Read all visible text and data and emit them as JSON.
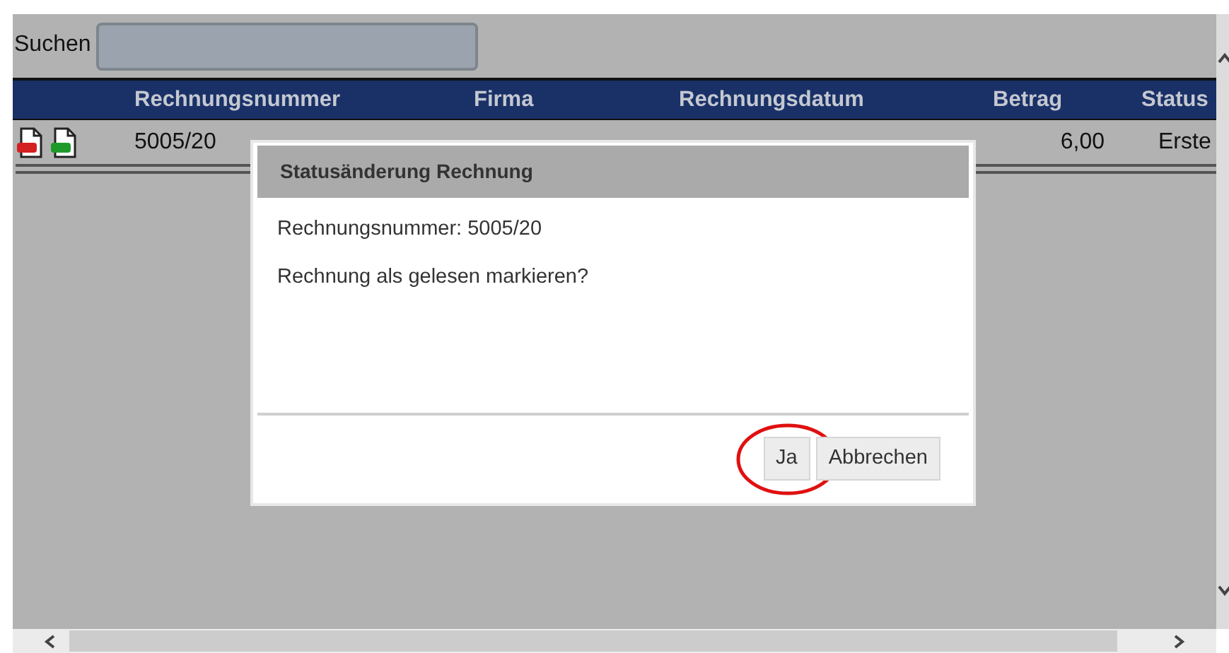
{
  "search": {
    "label": "Suchen"
  },
  "table": {
    "columns": [
      "Rechnungsnummer",
      "Firma",
      "Rechnungsdatum",
      "Betrag",
      "Status"
    ],
    "rows": [
      {
        "files": [
          {
            "kind": "pdf"
          },
          {
            "kind": "xls"
          }
        ],
        "rechnungsnummer": "5005/20",
        "betrag": "6,00",
        "status": "Erste"
      }
    ]
  },
  "dialog": {
    "title": "Statusänderung Rechnung",
    "lines": [
      "Rechnungsnummer: 5005/20",
      "Rechnung als gelesen markieren?"
    ],
    "buttons": [
      {
        "label": "Ja",
        "highlighted": true
      },
      {
        "label": "Abbrechen",
        "highlighted": false
      }
    ]
  }
}
